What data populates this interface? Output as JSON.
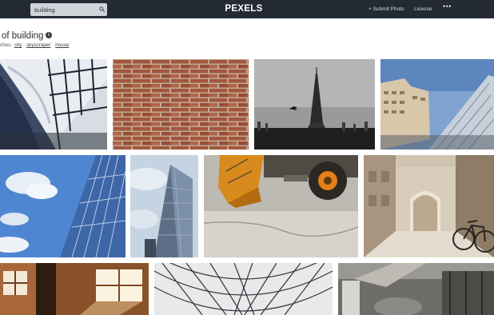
{
  "header": {
    "search_value": "building",
    "logo": "PEXELS",
    "submit_photo": "+ Submit Photo",
    "license": "License",
    "more": "•••"
  },
  "title": "of building",
  "info_icon": "i",
  "related": {
    "prefix": "ches:",
    "tags": [
      "city",
      "skyscraper",
      "house"
    ]
  },
  "icons": {
    "search": "search-icon",
    "info": "info-icon",
    "more": "more-icon"
  },
  "photos": [
    {
      "subject": "library-interior"
    },
    {
      "subject": "brick-wall"
    },
    {
      "subject": "eiffel-tower"
    },
    {
      "subject": "glass-skyscraper"
    },
    {
      "subject": "glass-facade-sky"
    },
    {
      "subject": "tower-low-angle"
    },
    {
      "subject": "excavator"
    },
    {
      "subject": "bicycle-archway"
    },
    {
      "subject": "sunlit-warehouse"
    },
    {
      "subject": "geodesic-roof"
    },
    {
      "subject": "industrial-interior"
    }
  ],
  "colors": {
    "topbar": "#232a34",
    "search_bg": "#cfd4d9",
    "logo": "#ffffff"
  }
}
